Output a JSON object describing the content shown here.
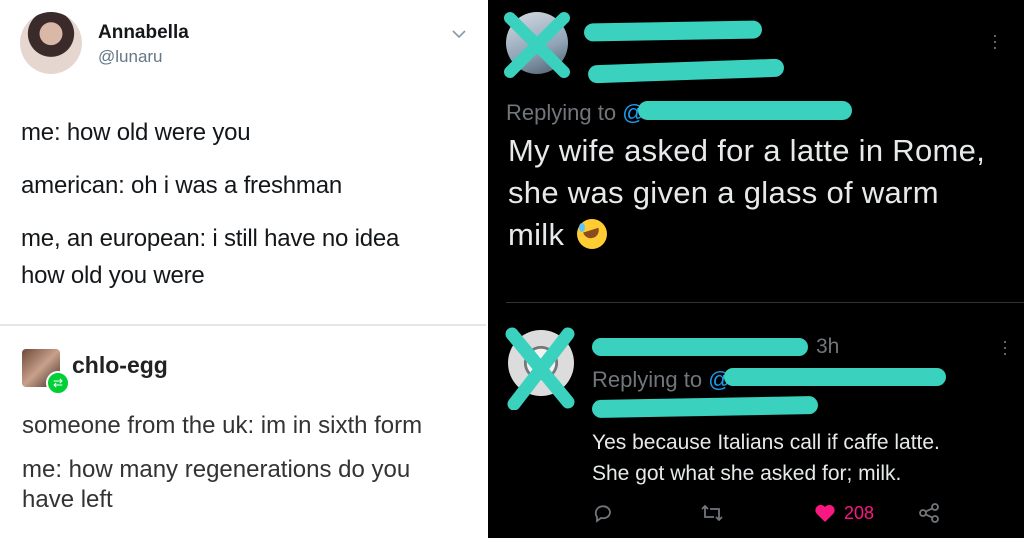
{
  "left": {
    "twitter_post": {
      "name": "Annabella",
      "handle": "@lunaru",
      "lines": [
        "me: how old were you",
        "american: oh i was a freshman",
        "me, an european: i still have no idea",
        "how old you were"
      ]
    },
    "tumblr_post": {
      "name": "chlo-egg",
      "lines": [
        "someone from the uk: im in sixth form",
        "me: how many regenerations do you",
        "have left"
      ]
    }
  },
  "right": {
    "tweet1": {
      "replying_label": "Replying to",
      "replying_at": "@",
      "body": [
        "My wife asked for a latte in Rome,",
        "she was given a glass of warm",
        "milk"
      ]
    },
    "tweet2": {
      "time": "3h",
      "replying_label": "Replying to",
      "replying_at": "@",
      "body": [
        "Yes because Italians call if caffe latte.",
        "She got what she asked for; milk."
      ],
      "likes": "208"
    }
  },
  "colors": {
    "censor": "#3ad1bf",
    "like": "#f91880",
    "link": "#1d9bf0"
  }
}
